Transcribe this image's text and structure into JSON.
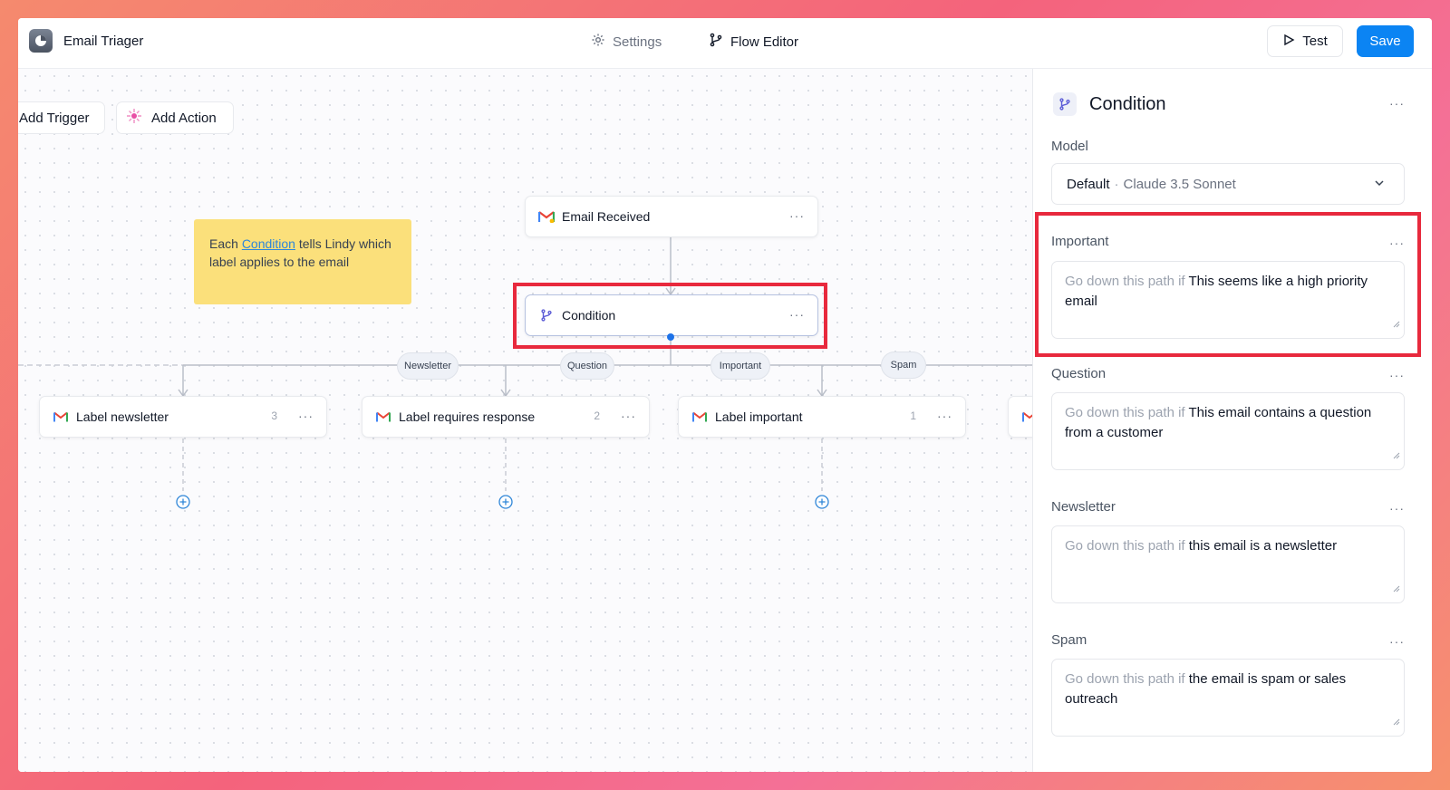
{
  "app": {
    "title": "Email Triager"
  },
  "nav": {
    "settings": "Settings",
    "flow_editor": "Flow Editor"
  },
  "toolbar": {
    "test": "Test",
    "save": "Save"
  },
  "canvas": {
    "add_trigger": "Add Trigger",
    "add_action": "Add Action",
    "note": {
      "pre": "Each ",
      "link": "Condition",
      "post": " tells Lindy which label applies to the email"
    },
    "trigger_node": {
      "label": "Email Received"
    },
    "condition_node": {
      "label": "Condition"
    },
    "branches": [
      "Newsletter",
      "Question",
      "Important",
      "Spam"
    ],
    "action_nodes": [
      {
        "label": "Label newsletter",
        "count": "3"
      },
      {
        "label": "Label requires response",
        "count": "2"
      },
      {
        "label": "Label important",
        "count": "1"
      }
    ]
  },
  "panel": {
    "title": "Condition",
    "model_label": "Model",
    "model_value": "Default",
    "model_sub": "Claude 3.5 Sonnet",
    "path_prefix": "Go down this path if",
    "paths": [
      {
        "name": "Important",
        "condition": "This seems like a high priority email"
      },
      {
        "name": "Question",
        "condition": "This email contains a question from a customer"
      },
      {
        "name": "Newsletter",
        "condition": "this email is a newsletter"
      },
      {
        "name": "Spam",
        "condition": "the email is spam or sales outreach"
      }
    ]
  },
  "colors": {
    "accent": "#0b84f3",
    "highlight": "#e8293d",
    "note": "#fbe07b"
  }
}
